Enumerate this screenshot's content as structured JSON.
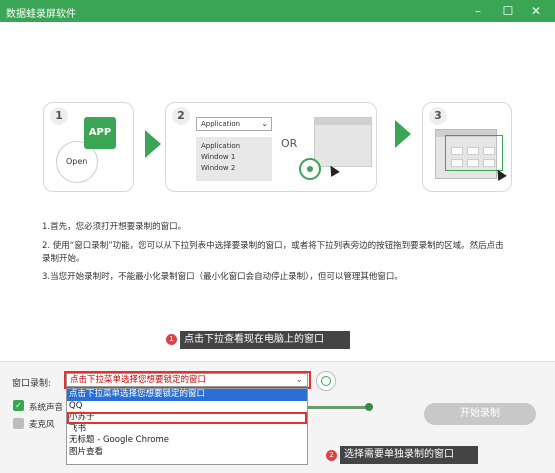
{
  "window": {
    "title": "数据蛙录屏软件"
  },
  "steps": {
    "step1": {
      "num": "1",
      "app_label": "APP",
      "open_label": "Open"
    },
    "step2": {
      "num": "2",
      "dropdown_label": "Application",
      "list_items": [
        "Application",
        "Window 1",
        "Window 2"
      ],
      "or_label": "OR"
    },
    "step3": {
      "num": "3"
    }
  },
  "instructions": {
    "line1": "1.首先，您必须打开想要录制的窗口。",
    "line2": "2. 使用“窗口录制”功能，您可以从下拉列表中选择要录制的窗口，或者将下拉列表旁边的按钮拖到要录制的区域。然后点击录制开始。",
    "line3": "3.当您开始录制时，不能最小化录制窗口（最小化窗口会自动停止录制），但可以管理其他窗口。"
  },
  "tips": {
    "tip1_num": "1",
    "tip1": "点击下拉查看现在电脑上的窗口",
    "tip2_num": "2",
    "tip2": "选择需要单独录制的窗口"
  },
  "controls": {
    "window_record_label": "窗口录制:",
    "select_value": "点击下拉菜单选择您想要锁定的窗口",
    "options": [
      "点击下拉菜单选择您想要锁定的窗口",
      "QQ",
      "小苏子",
      "飞书",
      "无标题 - Google Chrome",
      "图片查看"
    ],
    "selected_index": 0,
    "highlighted_index": 2,
    "system_audio_label": "系统声音",
    "mic_label": "麦克风",
    "system_audio_checked": true,
    "mic_checked": false,
    "start_label": "开始录制"
  },
  "colors": {
    "brand": "#3aa655",
    "highlight": "#d33333",
    "selection": "#2a6fd6"
  }
}
